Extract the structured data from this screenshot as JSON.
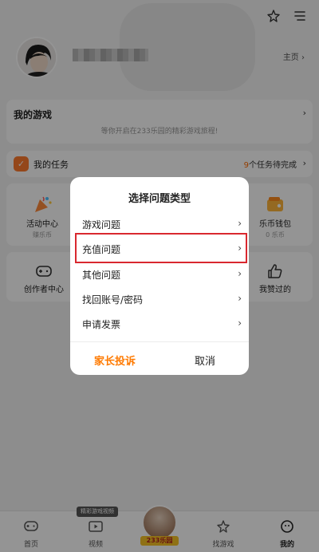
{
  "header": {
    "homepage_label": "主页",
    "homepage_chevron": "›",
    "icon_theme": "sparkle-outline-icon",
    "icon_menu": "menu-icon"
  },
  "my_games": {
    "title": "我的游戏",
    "hint": "等你开启在233乐园的精彩游戏旅程!",
    "chevron": "›"
  },
  "tasks": {
    "icon_text": "✓",
    "label": "我的任务",
    "count": "9",
    "count_suffix": "个任务待完成",
    "chevron": "›"
  },
  "grid_row1": [
    {
      "title": "活动中心",
      "sub": "赚乐币"
    },
    {
      "title": "乐币钱包",
      "sub": "0 乐币"
    }
  ],
  "grid_row2": [
    {
      "title": "创作者中心"
    },
    {
      "title": "我赞过的"
    }
  ],
  "dialog": {
    "title": "选择问题类型",
    "options": [
      {
        "label": "游戏问题",
        "chevron": "›"
      },
      {
        "label": "充值问题",
        "chevron": "›"
      },
      {
        "label": "其他问题",
        "chevron": "›"
      },
      {
        "label": "找回账号/密码",
        "chevron": "›"
      },
      {
        "label": "申请发票",
        "chevron": "›"
      }
    ],
    "btn_parent": "家长投诉",
    "btn_cancel": "取消",
    "highlighted_option": "充值问题",
    "highlight_color": "#d9282f",
    "accent_color": "#ff7a00"
  },
  "nav": {
    "video_tag": "精彩游戏视频",
    "center_brand": "233乐园",
    "items": [
      {
        "label": "首页",
        "icon": "gamepad-icon"
      },
      {
        "label": "视频",
        "icon": "tv-play-icon"
      },
      {
        "label": "找游戏",
        "icon": "star-badge-icon"
      },
      {
        "label": "我的",
        "icon": "profile-icon"
      }
    ],
    "active": "我的"
  }
}
